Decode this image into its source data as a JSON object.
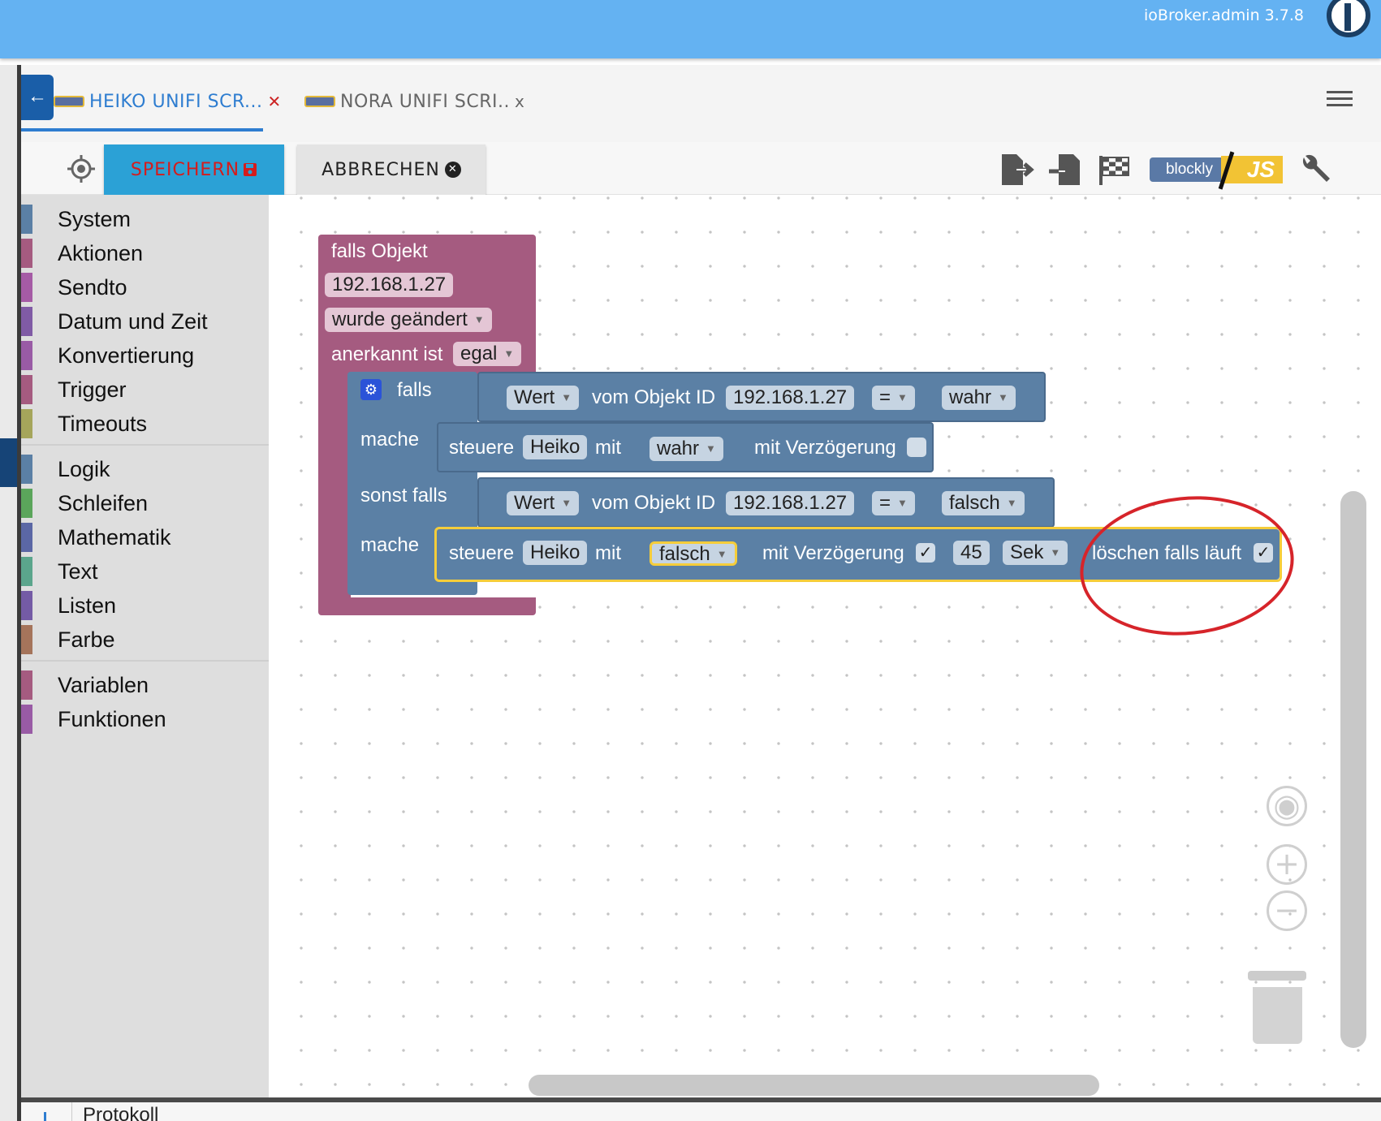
{
  "app": {
    "version": "ioBroker.admin 3.7.8"
  },
  "tabs": [
    {
      "label": "HEIKO UNIFI SCR...",
      "close": "✕"
    },
    {
      "label": "NORA UNIFI SCRI..",
      "close": "x"
    }
  ],
  "toolbar": {
    "save_label": "SPEICHERN",
    "cancel_label": "ABBRECHEN",
    "blockly_label": "blockly",
    "js_label": "JS"
  },
  "categories": [
    {
      "label": "System",
      "color": "#5b80a5"
    },
    {
      "label": "Aktionen",
      "color": "#a55b80"
    },
    {
      "label": "Sendto",
      "color": "#a55ba5"
    },
    {
      "label": "Datum und Zeit",
      "color": "#805ba5"
    },
    {
      "label": "Konvertierung",
      "color": "#995ba5"
    },
    {
      "label": "Trigger",
      "color": "#a55b80"
    },
    {
      "label": "Timeouts",
      "color": "#a5a55b"
    },
    {
      "label": "Logik",
      "color": "#5b80a5"
    },
    {
      "label": "Schleifen",
      "color": "#5ba55b"
    },
    {
      "label": "Mathematik",
      "color": "#5b67a5"
    },
    {
      "label": "Text",
      "color": "#5ba58c"
    },
    {
      "label": "Listen",
      "color": "#745ba5"
    },
    {
      "label": "Farbe",
      "color": "#a5745b"
    },
    {
      "label": "Variablen",
      "color": "#a55b80"
    },
    {
      "label": "Funktionen",
      "color": "#995ba5"
    }
  ],
  "blocks": {
    "trigger": {
      "title": "falls Objekt",
      "object_id": "192.168.1.27",
      "change": "wurde geändert",
      "ack_label": "anerkannt ist",
      "ack_value": "egal"
    },
    "if": {
      "falls": "falls",
      "mache1": "mache",
      "sonst_falls": "sonst falls",
      "mache2": "mache"
    },
    "cond1": {
      "wert": "Wert",
      "vom": "vom Objekt ID",
      "id": "192.168.1.27",
      "op": "=",
      "value": "wahr"
    },
    "action1": {
      "steuere": "steuere",
      "target": "Heiko",
      "mit": "mit",
      "value": "wahr",
      "delay_label": "mit Verzögerung",
      "delay_checked": ""
    },
    "cond2": {
      "wert": "Wert",
      "vom": "vom Objekt ID",
      "id": "192.168.1.27",
      "op": "=",
      "value": "falsch"
    },
    "action2": {
      "steuere": "steuere",
      "target": "Heiko",
      "mit": "mit",
      "value": "falsch",
      "delay_label": "mit Verzögerung",
      "delay_checked": "✓",
      "delay_value": "45",
      "unit": "Sek",
      "clear_label": "löschen falls läuft",
      "clear_checked": "✓"
    }
  },
  "bottom": {
    "label": "Protokoll"
  },
  "colors": {
    "accent": "#64b2f2",
    "save": "#2ba1d6",
    "trigger_block": "#a55b80",
    "logic_block": "#5b80a5",
    "highlight": "#f5cd3a",
    "annotation": "#d6242a"
  }
}
